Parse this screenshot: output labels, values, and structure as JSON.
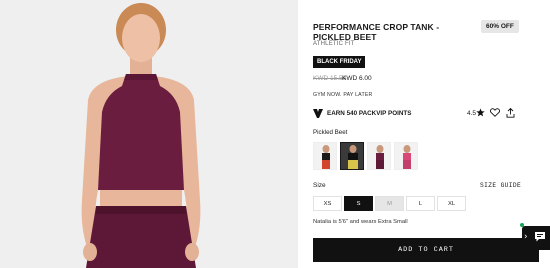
{
  "product": {
    "title": "PERFORMANCE CROP TANK - PICKLED BEET",
    "discount_badge": "60% OFF",
    "fit": "ATHLETIC FIT",
    "promo_tag": "BLACK FRIDAY",
    "old_price": "KWD 15.50",
    "new_price": "KWD 6.00",
    "pay_later": "GYM NOW. PAY LATER"
  },
  "loyalty": {
    "points_text": "EARN 540 PACKVIP POINTS",
    "rating": "4.5"
  },
  "color": {
    "label": "Pickled Beet",
    "swatches": [
      "black-red",
      "black-yellow",
      "plum",
      "pink"
    ],
    "selected_index": 1
  },
  "size": {
    "label": "Size",
    "guide": "SIZE GUIDE",
    "options": [
      "XS",
      "S",
      "M",
      "L",
      "XL"
    ],
    "selected": "S",
    "sold_out": [
      "M"
    ]
  },
  "model_note": "Natalia is 5'6\" and wears Extra Small",
  "cta": {
    "label": "ADD TO CART"
  },
  "colors": {
    "accent": "#111111",
    "garment": "#6b1d3f",
    "chat_online": "#19a35a"
  }
}
